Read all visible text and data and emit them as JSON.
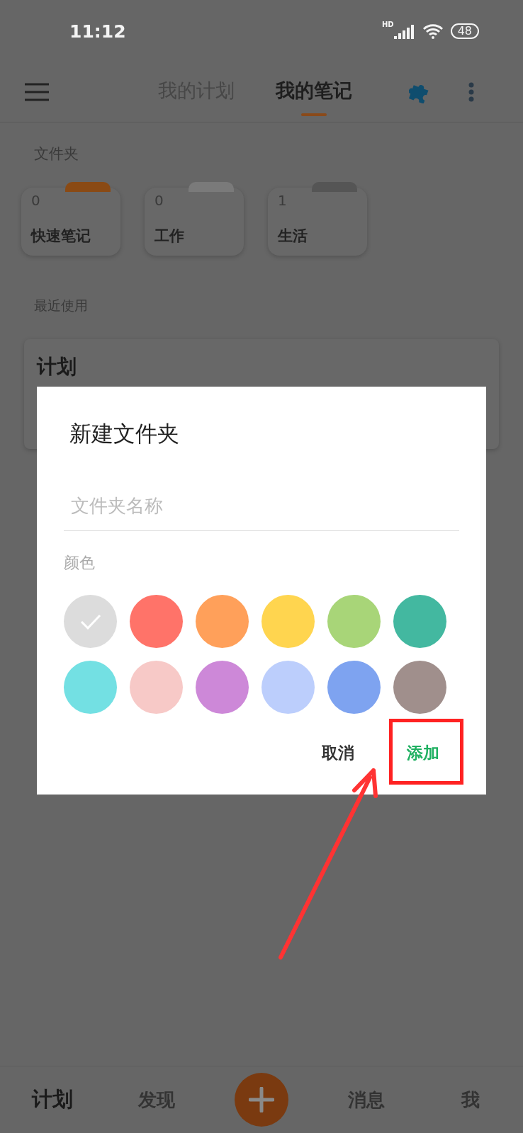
{
  "status_bar": {
    "time": "11:12",
    "network": "HD",
    "battery": "48"
  },
  "top_bar": {
    "tabs": [
      {
        "label": "我的计划",
        "selected": false
      },
      {
        "label": "我的笔记",
        "selected": true
      }
    ]
  },
  "folders_section": {
    "title": "文件夹",
    "folders": [
      {
        "count": "0",
        "name": "快速笔记",
        "color": "#8a4a14"
      },
      {
        "count": "0",
        "name": "工作",
        "color": "#7a7a7a"
      },
      {
        "count": "1",
        "name": "生活",
        "color": "#555555"
      }
    ]
  },
  "recent_section": {
    "title": "最近使用",
    "items": [
      {
        "title": "计划"
      }
    ]
  },
  "dialog": {
    "title": "新建文件夹",
    "name_field": {
      "placeholder": "文件夹名称"
    },
    "color_label": "颜色",
    "colors": [
      {
        "color": "#dcdcdc",
        "selected": true
      },
      {
        "color": "#ff7369",
        "selected": false
      },
      {
        "color": "#ffa05a",
        "selected": false
      },
      {
        "color": "#ffd54f",
        "selected": false
      },
      {
        "color": "#a8d578",
        "selected": false
      },
      {
        "color": "#43b8a0",
        "selected": false
      },
      {
        "color": "#73e0e3",
        "selected": false
      },
      {
        "color": "#f7c9c7",
        "selected": false
      },
      {
        "color": "#cd88d8",
        "selected": false
      },
      {
        "color": "#bccefc",
        "selected": false
      },
      {
        "color": "#7ea3f0",
        "selected": false
      },
      {
        "color": "#a08f8c",
        "selected": false
      }
    ],
    "buttons": [
      {
        "label": "取消",
        "kind": "cancel"
      },
      {
        "label": "添加",
        "kind": "confirm"
      }
    ]
  },
  "bottom_nav": {
    "items": [
      {
        "kind": "tab",
        "label": "计划",
        "selected": true
      },
      {
        "kind": "tab",
        "label": "发现",
        "selected": false
      },
      {
        "kind": "add"
      },
      {
        "kind": "tab",
        "label": "消息",
        "selected": false
      },
      {
        "kind": "tab",
        "label": "我",
        "selected": false
      }
    ]
  }
}
